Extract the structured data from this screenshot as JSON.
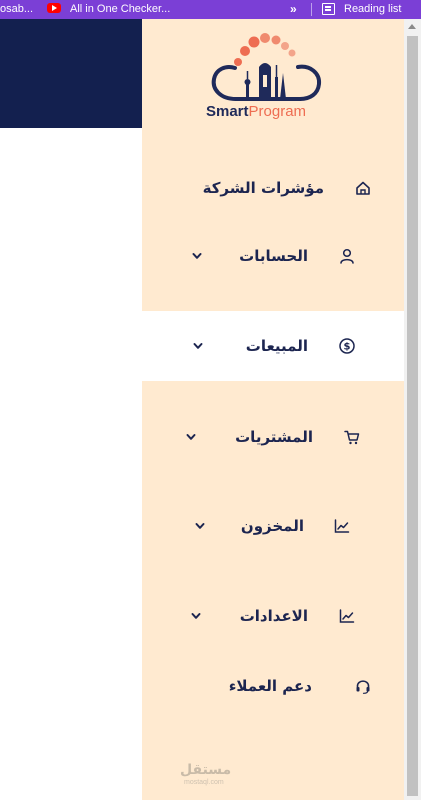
{
  "bookmarks_bar": {
    "items": [
      {
        "label": "osab..."
      },
      {
        "label": "All in One Checker..."
      },
      {
        "label": "»"
      },
      {
        "label": "Reading list"
      }
    ]
  },
  "sidebar": {
    "brand": {
      "part1": "Smart",
      "part2": "Program"
    },
    "menu": [
      {
        "label": "مؤشرات الشركة",
        "icon": "home-icon",
        "has_chevron": false
      },
      {
        "label": "الحسابات",
        "icon": "user-icon",
        "has_chevron": true
      },
      {
        "label": "المبيعات",
        "icon": "dollar-circle-icon",
        "has_chevron": true,
        "active": true
      },
      {
        "label": "المشتريات",
        "icon": "cart-icon",
        "has_chevron": true
      },
      {
        "label": "المخزون",
        "icon": "chart-line-icon",
        "has_chevron": true
      },
      {
        "label": "الاعدادات",
        "icon": "chart-line-icon",
        "has_chevron": true
      },
      {
        "label": "دعم العملاء",
        "icon": "headset-icon",
        "has_chevron": false
      }
    ],
    "watermark": {
      "text": "مستقل",
      "sub": "mostaql.com"
    }
  },
  "colors": {
    "bookmarks_bg": "#7b3fd6",
    "header_dark": "#13204f",
    "sidebar_bg": "#ffead0",
    "active_bg": "#ffffff",
    "text_dark": "#1c2550",
    "brand_orange": "#ee6d52"
  }
}
